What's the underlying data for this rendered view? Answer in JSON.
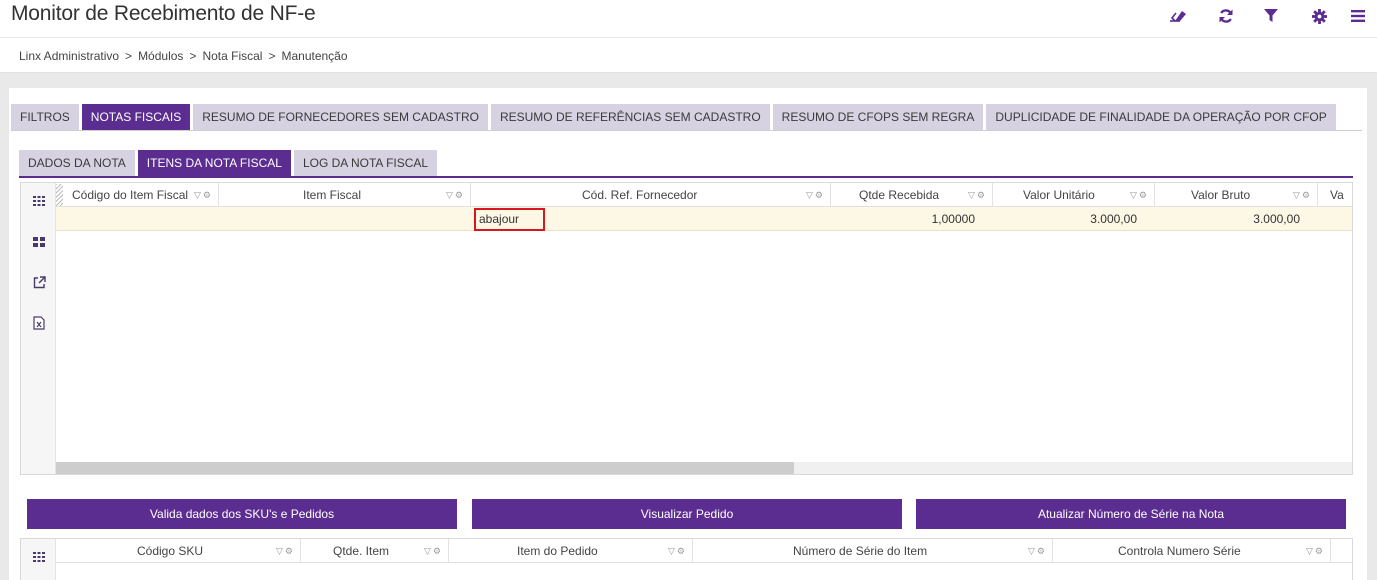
{
  "header": {
    "title": "Monitor de Recebimento de NF-e",
    "icons": [
      "eraser-icon",
      "refresh-icon",
      "filter-icon",
      "gear-icon",
      "menu-icon"
    ]
  },
  "breadcrumb": [
    "Linx Administrativo",
    "Módulos",
    "Nota Fiscal",
    "Manutenção"
  ],
  "breadcrumb_separator": ">",
  "tabs_main": [
    {
      "label": "FILTROS",
      "active": false
    },
    {
      "label": "NOTAS FISCAIS",
      "active": true
    },
    {
      "label": "RESUMO DE FORNECEDORES SEM CADASTRO",
      "active": false
    },
    {
      "label": "RESUMO DE REFERÊNCIAS SEM CADASTRO",
      "active": false
    },
    {
      "label": "RESUMO DE CFOPS SEM REGRA",
      "active": false
    },
    {
      "label": "DUPLICIDADE DE FINALIDADE DA OPERAÇÃO POR CFOP",
      "active": false
    }
  ],
  "tabs_sub": [
    {
      "label": "DADOS DA NOTA",
      "active": false
    },
    {
      "label": "ITENS DA NOTA FISCAL",
      "active": true
    },
    {
      "label": "LOG DA NOTA FISCAL",
      "active": false
    }
  ],
  "grid_items": {
    "tools": [
      "grid-icon",
      "layout-icon",
      "export-icon",
      "excel-icon"
    ],
    "columns": [
      "Código do Item Fiscal",
      "Item Fiscal",
      "Cód. Ref. Fornecedor",
      "Qtde Recebida",
      "Valor Unitário",
      "Valor Bruto",
      "Va"
    ],
    "rows": [
      {
        "codigo_item_fiscal": "",
        "item_fiscal": "",
        "cod_ref_fornecedor": "abajour",
        "qtde_recebida": "1,00000",
        "valor_unitario": "3.000,00",
        "valor_bruto": "3.000,00"
      }
    ]
  },
  "buttons": {
    "validate": "Valida dados dos SKU's e Pedidos",
    "view_order": "Visualizar Pedido",
    "update_serial": "Atualizar Número de Série na Nota"
  },
  "grid_sku": {
    "columns": [
      "Código SKU",
      "Qtde. Item",
      "Item do Pedido",
      "Número de Série do Item",
      "Controla Numero Série"
    ]
  },
  "colors": {
    "accent": "#5c2d91",
    "tab_inactive": "#d7d2e1",
    "selected_row": "#fdf7e6",
    "highlight_border": "#d9161b"
  }
}
